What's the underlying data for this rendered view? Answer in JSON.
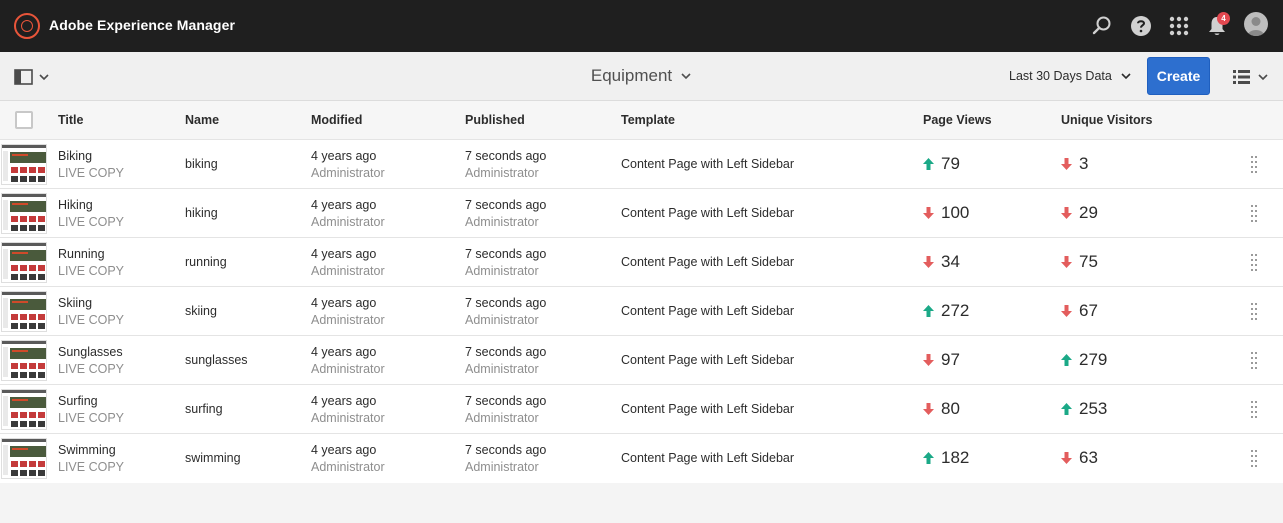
{
  "header": {
    "title": "Adobe Experience Manager",
    "icons": [
      "search-icon",
      "help-icon",
      "solutions-icon",
      "bell-icon",
      "avatar"
    ],
    "notification_count": "4"
  },
  "actionbar": {
    "breadcrumb": "Equipment",
    "range_label": "Last 30 Days Data",
    "create_label": "Create"
  },
  "columns": {
    "title": "Title",
    "name": "Name",
    "modified": "Modified",
    "published": "Published",
    "template": "Template",
    "page_views": "Page Views",
    "unique_visitors": "Unique Visitors"
  },
  "rows": [
    {
      "title": "Biking",
      "sub": "LIVE COPY",
      "name": "biking",
      "modified": "4 years ago",
      "modified_by": "Administrator",
      "published": "7 seconds ago",
      "published_by": "Administrator",
      "template": "Content Page with Left Sidebar",
      "views": "79",
      "views_trend": "up",
      "visitors": "3",
      "visitors_trend": "down"
    },
    {
      "title": "Hiking",
      "sub": "LIVE COPY",
      "name": "hiking",
      "modified": "4 years ago",
      "modified_by": "Administrator",
      "published": "7 seconds ago",
      "published_by": "Administrator",
      "template": "Content Page with Left Sidebar",
      "views": "100",
      "views_trend": "down",
      "visitors": "29",
      "visitors_trend": "down"
    },
    {
      "title": "Running",
      "sub": "LIVE COPY",
      "name": "running",
      "modified": "4 years ago",
      "modified_by": "Administrator",
      "published": "7 seconds ago",
      "published_by": "Administrator",
      "template": "Content Page with Left Sidebar",
      "views": "34",
      "views_trend": "down",
      "visitors": "75",
      "visitors_trend": "down"
    },
    {
      "title": "Skiing",
      "sub": "LIVE COPY",
      "name": "skiing",
      "modified": "4 years ago",
      "modified_by": "Administrator",
      "published": "7 seconds ago",
      "published_by": "Administrator",
      "template": "Content Page with Left Sidebar",
      "views": "272",
      "views_trend": "up",
      "visitors": "67",
      "visitors_trend": "down"
    },
    {
      "title": "Sunglasses",
      "sub": "LIVE COPY",
      "name": "sunglasses",
      "modified": "4 years ago",
      "modified_by": "Administrator",
      "published": "7 seconds ago",
      "published_by": "Administrator",
      "template": "Content Page with Left Sidebar",
      "views": "97",
      "views_trend": "down",
      "visitors": "279",
      "visitors_trend": "up"
    },
    {
      "title": "Surfing",
      "sub": "LIVE COPY",
      "name": "surfing",
      "modified": "4 years ago",
      "modified_by": "Administrator",
      "published": "7 seconds ago",
      "published_by": "Administrator",
      "template": "Content Page with Left Sidebar",
      "views": "80",
      "views_trend": "down",
      "visitors": "253",
      "visitors_trend": "up"
    },
    {
      "title": "Swimming",
      "sub": "LIVE COPY",
      "name": "swimming",
      "modified": "4 years ago",
      "modified_by": "Administrator",
      "published": "7 seconds ago",
      "published_by": "Administrator",
      "template": "Content Page with Left Sidebar",
      "views": "182",
      "views_trend": "up",
      "visitors": "63",
      "visitors_trend": "down"
    }
  ],
  "colors": {
    "up": "#1ba987",
    "down": "#e35d5d",
    "accent": "#2d6fcf",
    "brand": "#e8553a"
  }
}
